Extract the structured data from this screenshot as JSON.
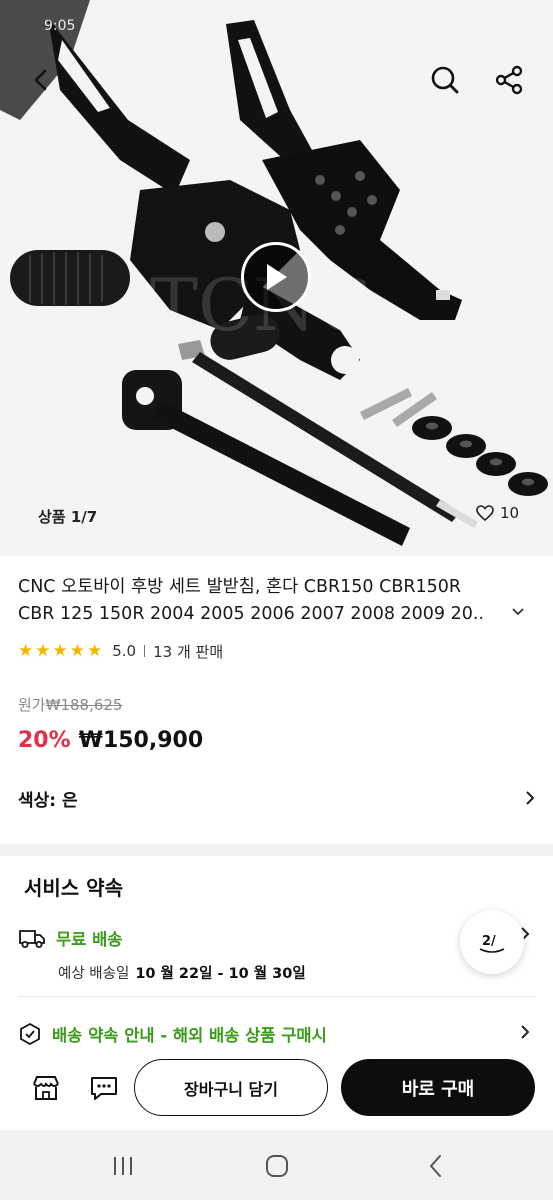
{
  "status_bar": {
    "time": "9:05"
  },
  "hero": {
    "watermark": "TCNC",
    "counter": "상품 1/7",
    "wish_count": "10"
  },
  "product": {
    "title_line1": "CNC 오토바이 후방 세트 발받침, 혼다 CBR150 CBR150R",
    "title_line2": "CBR 125 150R 2004 2005 2006 2007 2008 2009 20..",
    "rating": "5.0",
    "rating_stars": 5,
    "sold": "13 개 판매",
    "original_label": "원가",
    "original_price": "₩188,625",
    "discount": "20%",
    "price": "₩150,900",
    "color_option": "색상: 은"
  },
  "service": {
    "title": "서비스 약속",
    "free_shipping": "무료 배송",
    "est_label": "예상 배송일",
    "est_dates": "10 월 22일 - 10 월 30일",
    "policy": "배송 약속 안내 - 해외 배송 상품 구매시",
    "page_badge": "2/"
  },
  "actions": {
    "cart": "장바구니 담기",
    "buy": "바로 구매"
  },
  "colors": {
    "accent_red": "#e0314b",
    "accent_green": "#3b9c1c",
    "star": "#f7b500",
    "buy_bg": "#0d0d0d"
  },
  "icons": [
    "back-icon",
    "search-icon",
    "share-icon",
    "play-icon",
    "heart-icon",
    "truck-icon",
    "policy-icon",
    "store-icon",
    "chat-icon",
    "recent-apps-icon",
    "home-icon",
    "nav-back-icon"
  ]
}
